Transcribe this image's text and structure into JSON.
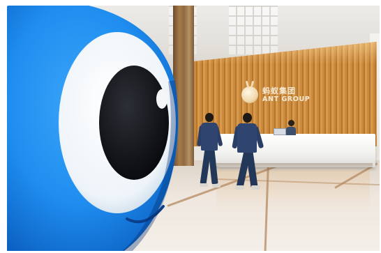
{
  "image": {
    "subject": "lobby-with-mascot",
    "brand_colors": {
      "mascot_blue": "#1f8ef0",
      "wood": "#c98a3e",
      "uniform": "#2f4570"
    },
    "logo": {
      "chinese_text": "蚂蚁集团",
      "english_text": "ANT GROUP",
      "icon": "ant-logo-icon"
    }
  }
}
